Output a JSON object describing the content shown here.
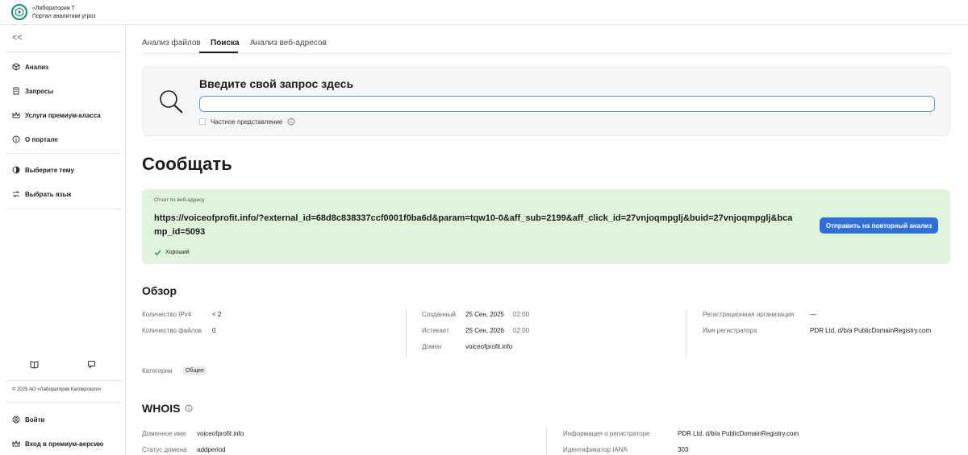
{
  "brand": {
    "line1": "«Лаборатория Т",
    "line2": "Портал аналитики угроз"
  },
  "sidebar": {
    "collapse": "<<",
    "items": [
      {
        "label": "Анализ",
        "icon": "cube-icon"
      },
      {
        "label": "Запросы",
        "icon": "document-icon"
      },
      {
        "label": "Услуги премиум-класса",
        "icon": "crown-icon"
      },
      {
        "label": "О портале",
        "icon": "info-icon"
      }
    ],
    "settings": [
      {
        "label": "Выберите тему",
        "icon": "theme-icon"
      },
      {
        "label": "Выбрать язык",
        "icon": "language-icon"
      }
    ],
    "bottom_icons": [
      "book-icon",
      "chat-icon"
    ],
    "copyright": "© 2025 АО «Лаборатория Касперского»",
    "login": "Войти",
    "premium_login": "Вход в премиум-версию"
  },
  "tabs": [
    "Анализ файлов",
    "Поиска",
    "Анализ веб-адресов"
  ],
  "search": {
    "title": "Введите свой запрос здесь",
    "value": "",
    "private_label": "Частное представление"
  },
  "heading": "Сообщать",
  "report": {
    "label": "Отчет по веб-адресу",
    "url": "https://voiceofprofit.info/?external_id=68d8c838337ccf0001f0ba6d&param=tqw10-0&aff_sub=2199&aff_click_id=27vnjoqmpglj&buid=27vnjoqmpglj&bcamp_id=5093",
    "verdict": "Хороший",
    "reanalyze_button": "Отправить на повторный анализ",
    "color": "#e0f4dc"
  },
  "overview": {
    "title": "Обзор",
    "col1": [
      {
        "label": "Количество IPv4",
        "value": "< 2"
      },
      {
        "label": "Количество файлов",
        "value": "0"
      }
    ],
    "col2": [
      {
        "label": "Созданный",
        "value": "25 Сен, 2025",
        "time": "02:00"
      },
      {
        "label": "Истекает",
        "value": "25 Сен, 2026",
        "time": "02:00"
      },
      {
        "label": "Домен",
        "value": "voiceofprofit.info"
      }
    ],
    "col3": [
      {
        "label": "Регистрационная организация",
        "value": "—"
      },
      {
        "label": "Имя регистратора",
        "value": "PDR Ltd. d/b/a PublicDomainRegistry.com"
      }
    ],
    "categories_label": "Категории",
    "category": "Общее"
  },
  "whois": {
    "title": "WHOIS",
    "left": [
      {
        "label": "Доменное имя",
        "value": "voiceofprofit.info"
      },
      {
        "label": "Статус домена",
        "value": "addperiod"
      }
    ],
    "right": [
      {
        "label": "Информация о регистраторе",
        "value": "PDR Ltd. d/b/a PublicDomainRegistry.com"
      },
      {
        "label": "Идентификатор IANA",
        "value": "303"
      }
    ]
  },
  "colors": {
    "accent": "#2f6fdc",
    "brand": "#1b8a76",
    "search_border": "#5aa0d8"
  }
}
